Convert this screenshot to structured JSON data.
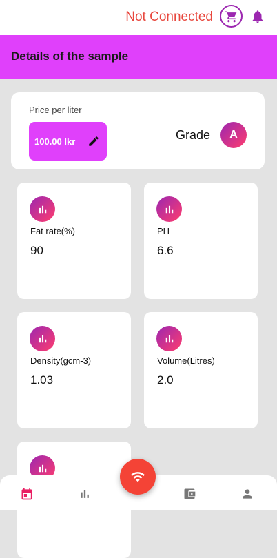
{
  "status": {
    "connection_text": "Not Connected"
  },
  "header": {
    "title": "Details of the sample"
  },
  "price_card": {
    "label": "Price per liter",
    "value": "100.00 lkr",
    "grade_label": "Grade",
    "grade_value": "A"
  },
  "metrics": [
    {
      "label": "Fat rate(%)",
      "value": "90"
    },
    {
      "label": "PH",
      "value": "6.6"
    },
    {
      "label": "Density(gcm-3)",
      "value": "1.03"
    },
    {
      "label": "Volume(Litres)",
      "value": "2.0"
    }
  ],
  "bottom_nav": {
    "items": [
      "calendar-icon",
      "bar-chart-icon",
      "wallet-icon",
      "person-icon"
    ],
    "fab_icon": "wifi-icon",
    "active_color": "#e91e63"
  },
  "colors": {
    "accent": "#e040fb",
    "status_error": "#e8473d",
    "cart_icon": "#9c27b0",
    "fab": "#f44336"
  }
}
